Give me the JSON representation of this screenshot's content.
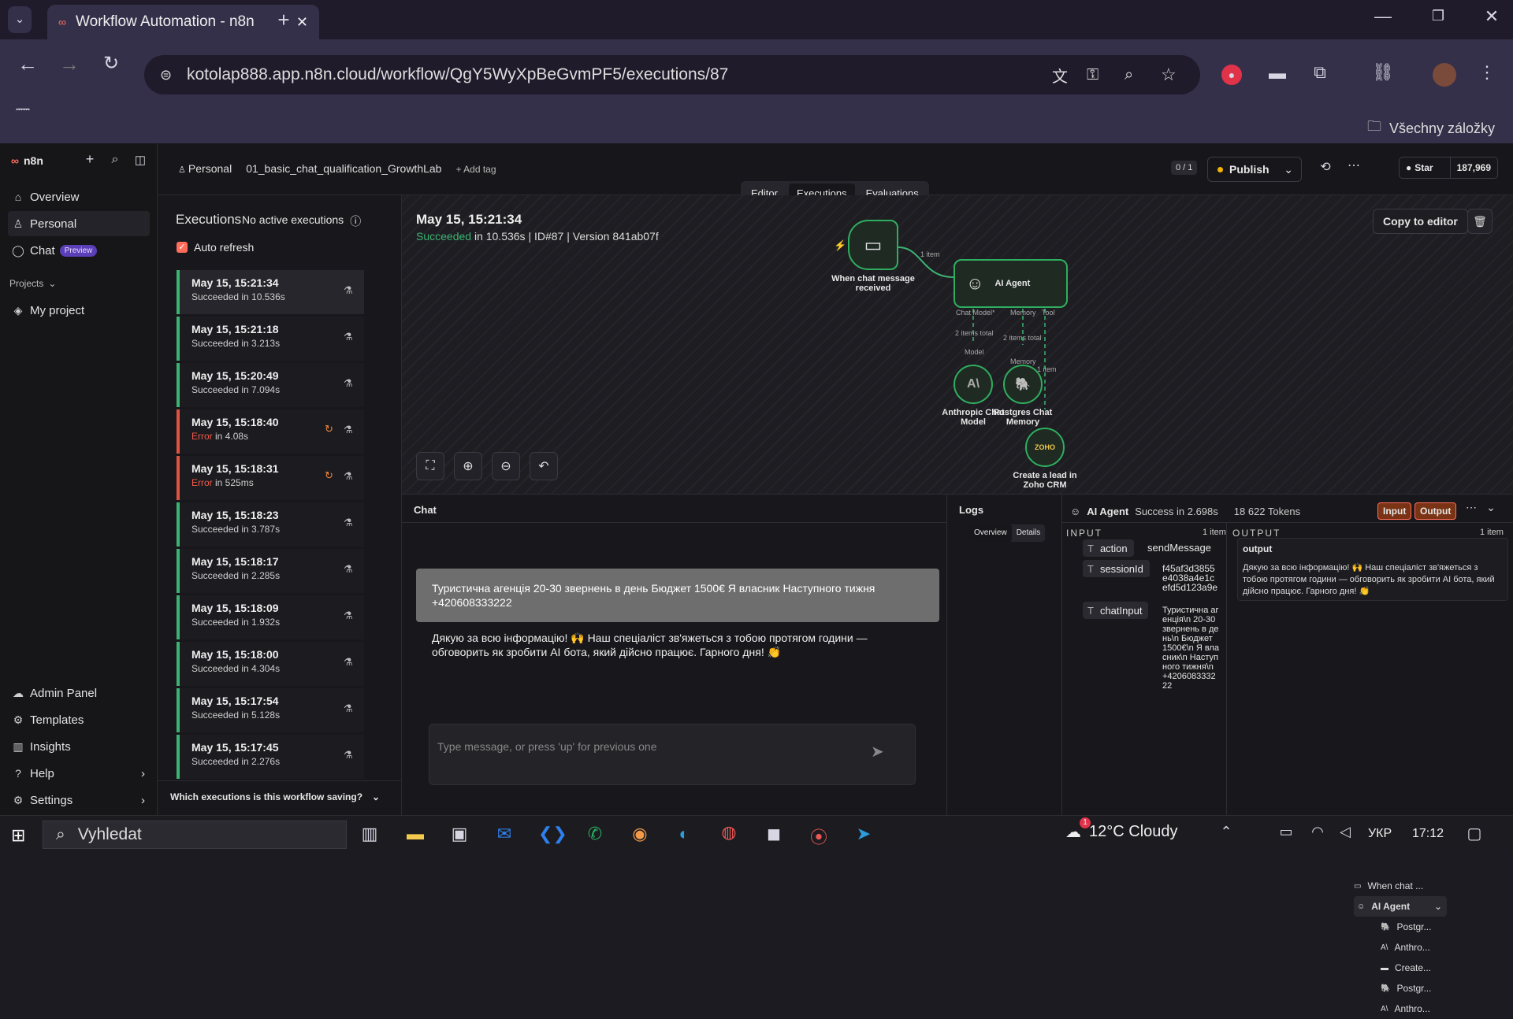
{
  "browser": {
    "tab_title": "Workflow Automation - n8n",
    "url": "kotolap888.app.n8n.cloud/workflow/QgY5WyXpBeGvmPF5/executions/87",
    "bookmarks_label": "Všechny záložky"
  },
  "sidebar": {
    "logo": "n8n",
    "items": [
      {
        "label": "Overview"
      },
      {
        "label": "Personal"
      },
      {
        "label": "Chat"
      }
    ],
    "chat_badge": "Preview",
    "projects_label": "Projects",
    "my_project": "My project",
    "bottom_items": [
      {
        "label": "Admin Panel"
      },
      {
        "label": "Templates"
      },
      {
        "label": "Insights"
      },
      {
        "label": "Help"
      },
      {
        "label": "Settings"
      }
    ]
  },
  "header": {
    "breadcrumb_personal": "Personal",
    "workflow_name": "01_basic_chat_qualification_GrowthLab",
    "add_tag": "+ Add tag",
    "counter": "0 / 1",
    "publish": "Publish",
    "star": "Star",
    "star_count": "187,969",
    "tabs": [
      "Editor",
      "Executions",
      "Evaluations"
    ]
  },
  "executions": {
    "title": "Executions",
    "no_active": "No active executions",
    "auto_refresh": "Auto refresh",
    "footer": "Which executions is this workflow saving?",
    "items": [
      {
        "date": "May 15, 15:21:34",
        "status": "Succeeded in 10.536s",
        "error": false
      },
      {
        "date": "May 15, 15:21:18",
        "status": "Succeeded in 3.213s",
        "error": false
      },
      {
        "date": "May 15, 15:20:49",
        "status": "Succeeded in 7.094s",
        "error": false
      },
      {
        "date": "May 15, 15:18:40",
        "status_prefix": "Error",
        "status": " in 4.08s",
        "error": true
      },
      {
        "date": "May 15, 15:18:31",
        "status_prefix": "Error",
        "status": " in 525ms",
        "error": true
      },
      {
        "date": "May 15, 15:18:23",
        "status": "Succeeded in 3.787s",
        "error": false
      },
      {
        "date": "May 15, 15:18:17",
        "status": "Succeeded in 2.285s",
        "error": false
      },
      {
        "date": "May 15, 15:18:09",
        "status": "Succeeded in 1.932s",
        "error": false
      },
      {
        "date": "May 15, 15:18:00",
        "status": "Succeeded in 4.304s",
        "error": false
      },
      {
        "date": "May 15, 15:17:54",
        "status": "Succeeded in 5.128s",
        "error": false
      },
      {
        "date": "May 15, 15:17:45",
        "status": "Succeeded in 2.276s",
        "error": false
      }
    ]
  },
  "canvas": {
    "exec_date": "May 15, 15:21:34",
    "exec_succeeded": "Succeeded",
    "exec_meta": "in 10.536s | ID#87 | Version 841ab07f",
    "copy_to_editor": "Copy to editor",
    "nodes": {
      "trigger": "When chat message received",
      "agent": "AI Agent",
      "anthropic": "Anthropic Chat Model",
      "postgres": "Postgres Chat Memory",
      "zoho": "Create a lead in Zoho CRM"
    },
    "ports": {
      "chat_model": "Chat Model*",
      "memory": "Memory",
      "tool": "Tool",
      "model": "Model",
      "memory2": "Memory"
    },
    "edge_labels": {
      "one_item": "1 item",
      "two_items_a": "2 items total",
      "two_items_b": "2 items total",
      "one_item_b": "1 item"
    }
  },
  "chat": {
    "title": "Chat",
    "user_message": "Туристична агенція 20-30 звернень в день Бюджет 1500€ Я власник Наступного тижня +420608333222",
    "bot_message": "Дякую за всю інформацію! 🙌 Наш спеціаліст зв'яжеться з тобою протягом години — обговорить як зробити AI бота, який дійсно працює. Гарного дня! 👏",
    "input_placeholder": "Type message, or press 'up' for previous one"
  },
  "logs": {
    "title": "Logs",
    "overview": "Overview",
    "details": "Details",
    "tree": [
      "When chat ...",
      "AI Agent",
      "Postgr...",
      "Anthro...",
      "Create...",
      "Postgr...",
      "Anthro..."
    ],
    "agent_name": "AI Agent",
    "agent_status": "Success in 2.698s",
    "tokens": "18 622 Tokens",
    "input_btn": "Input",
    "output_btn": "Output",
    "input_label": "INPUT",
    "input_count": "1 item",
    "output_label": "OUTPUT",
    "output_count": "1 item",
    "fields": [
      {
        "key": "action",
        "value": "sendMessage"
      },
      {
        "key": "sessionId",
        "value": "f45af3d3855e4038a4e1cefd5d123a9e"
      },
      {
        "key": "chatInput",
        "value": "Туристична агенція\\n 20-30 звернень в день\\n Бюджет 1500€\\n Я власник\\n Наступного тижня\\n +420608333222"
      }
    ],
    "output_key": "output",
    "output_value": "Дякую за всю інформацію! 🙌 Наш спеціаліст зв'яжеться з тобою протягом години — обговорить як зробити AI бота, який дійсно працює. Гарного дня! 👏"
  },
  "taskbar": {
    "search": "Vyhledat",
    "weather": "12°C Cloudy",
    "weather_badge": "1",
    "lang": "УКР",
    "time": "17:12"
  },
  "colors": {
    "success": "#3cb371",
    "error": "#e0533f",
    "accent": "#ff6d5a",
    "publish_dot": "#f5b400"
  }
}
